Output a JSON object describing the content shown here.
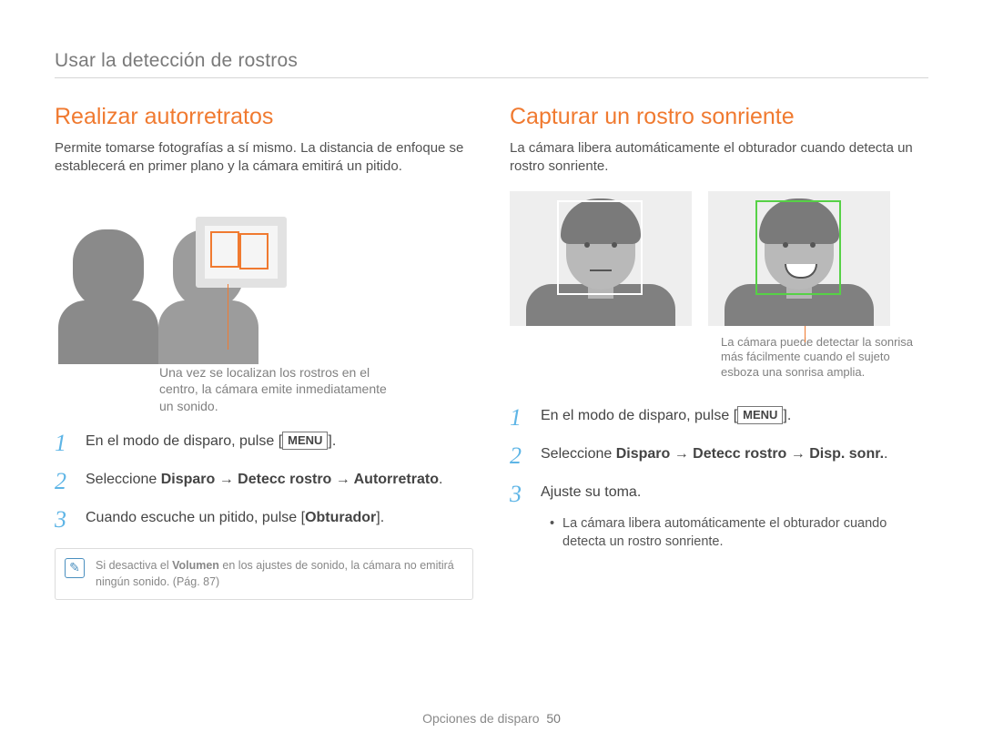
{
  "header": "Usar la detección de rostros",
  "left": {
    "title": "Realizar autorretratos",
    "intro": "Permite tomarse fotografías a sí mismo. La distancia de enfoque se establecerá en primer plano y la cámara emitirá un pitido.",
    "callout": "Una vez se localizan los rostros en el centro, la cámara emite inmediatamente un sonido.",
    "steps": {
      "s1_pre": "En el modo de disparo, pulse [",
      "s1_menu": "MENU",
      "s1_post": "].",
      "s2_pre": "Seleccione ",
      "s2_bold": "Disparo → Detecc rostro → Autorretrato",
      "s2_post": ".",
      "s3_pre": "Cuando escuche un pitido, pulse [",
      "s3_bold": "Obturador",
      "s3_post": "]."
    },
    "note_pre": "Si desactiva el ",
    "note_bold": "Volumen",
    "note_post": " en los ajustes de sonido, la cámara no emitirá ningún sonido. (Pág. 87)"
  },
  "right": {
    "title": "Capturar un rostro sonriente",
    "intro": "La cámara libera automáticamente el obturador cuando detecta un rostro sonriente.",
    "smile_note": "La cámara puede detectar la sonrisa más fácilmente cuando el sujeto esboza una sonrisa amplia.",
    "steps": {
      "s1_pre": "En el modo de disparo, pulse [",
      "s1_menu": "MENU",
      "s1_post": "].",
      "s2_pre": "Seleccione ",
      "s2_bold": "Disparo → Detecc rostro → Disp. sonr.",
      "s2_post": ".",
      "s3": "Ajuste su toma."
    },
    "bullet": "La cámara libera automáticamente el obturador cuando detecta un rostro sonriente."
  },
  "footer": {
    "section": "Opciones de disparo",
    "page": "50"
  }
}
